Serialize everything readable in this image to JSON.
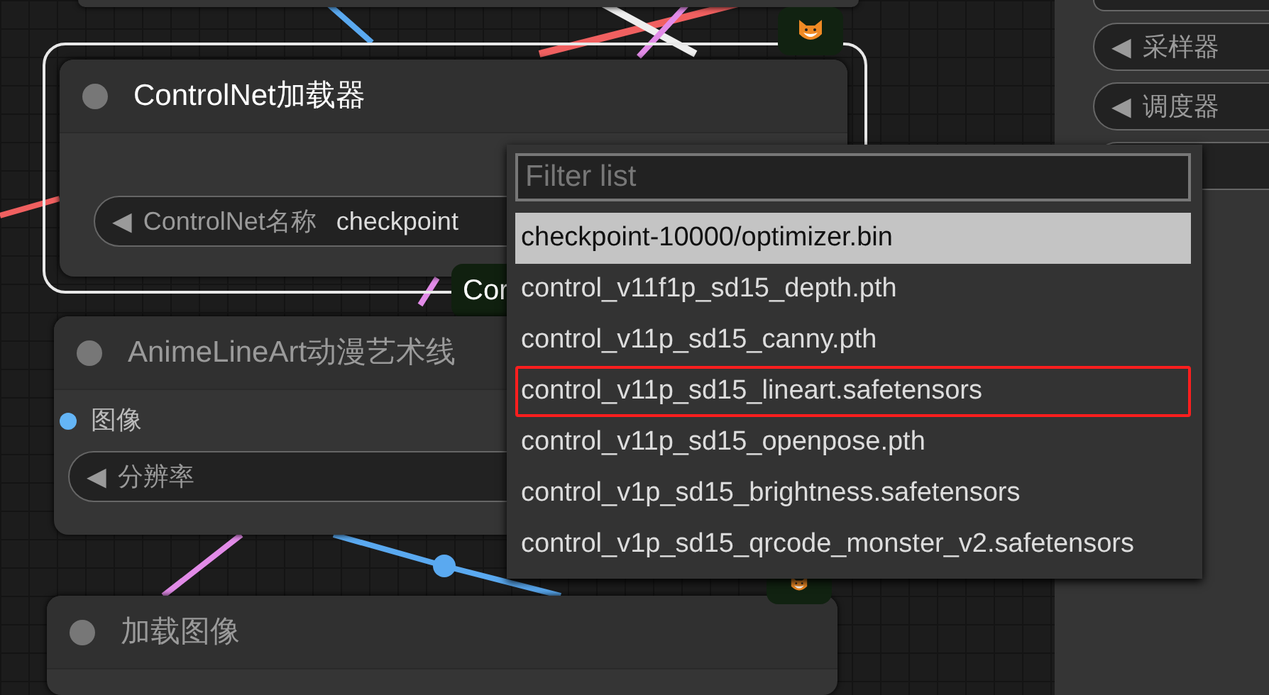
{
  "nodes": [
    {
      "title": "ControlNet加载器",
      "selected": true,
      "widgets": [
        {
          "arrow": "◀",
          "label": "ControlNet名称",
          "value": "checkpoint"
        }
      ],
      "badge": "Cor"
    },
    {
      "title": "AnimeLineArt动漫艺术线",
      "selected": false,
      "inputs": [
        {
          "label": "图像",
          "color": "#64b5f6"
        }
      ],
      "widgets": [
        {
          "arrow": "◀",
          "label": "分辨率"
        }
      ]
    },
    {
      "title": "加载图像",
      "selected": false
    }
  ],
  "side_panel": {
    "widgets": [
      {
        "arrow": "◀",
        "label": "采样器"
      },
      {
        "arrow": "◀",
        "label": "调度器"
      }
    ]
  },
  "dropdown": {
    "placeholder": "Filter list",
    "items": [
      {
        "label": "checkpoint-10000/optimizer.bin",
        "selected": true,
        "marked": false
      },
      {
        "label": "control_v11f1p_sd15_depth.pth",
        "selected": false,
        "marked": false
      },
      {
        "label": "control_v11p_sd15_canny.pth",
        "selected": false,
        "marked": false
      },
      {
        "label": "control_v11p_sd15_lineart.safetensors",
        "selected": false,
        "marked": true
      },
      {
        "label": "control_v11p_sd15_openpose.pth",
        "selected": false,
        "marked": false
      },
      {
        "label": "control_v1p_sd15_brightness.safetensors",
        "selected": false,
        "marked": false
      },
      {
        "label": "control_v1p_sd15_qrcode_monster_v2.safetensors",
        "selected": false,
        "marked": false
      }
    ]
  }
}
